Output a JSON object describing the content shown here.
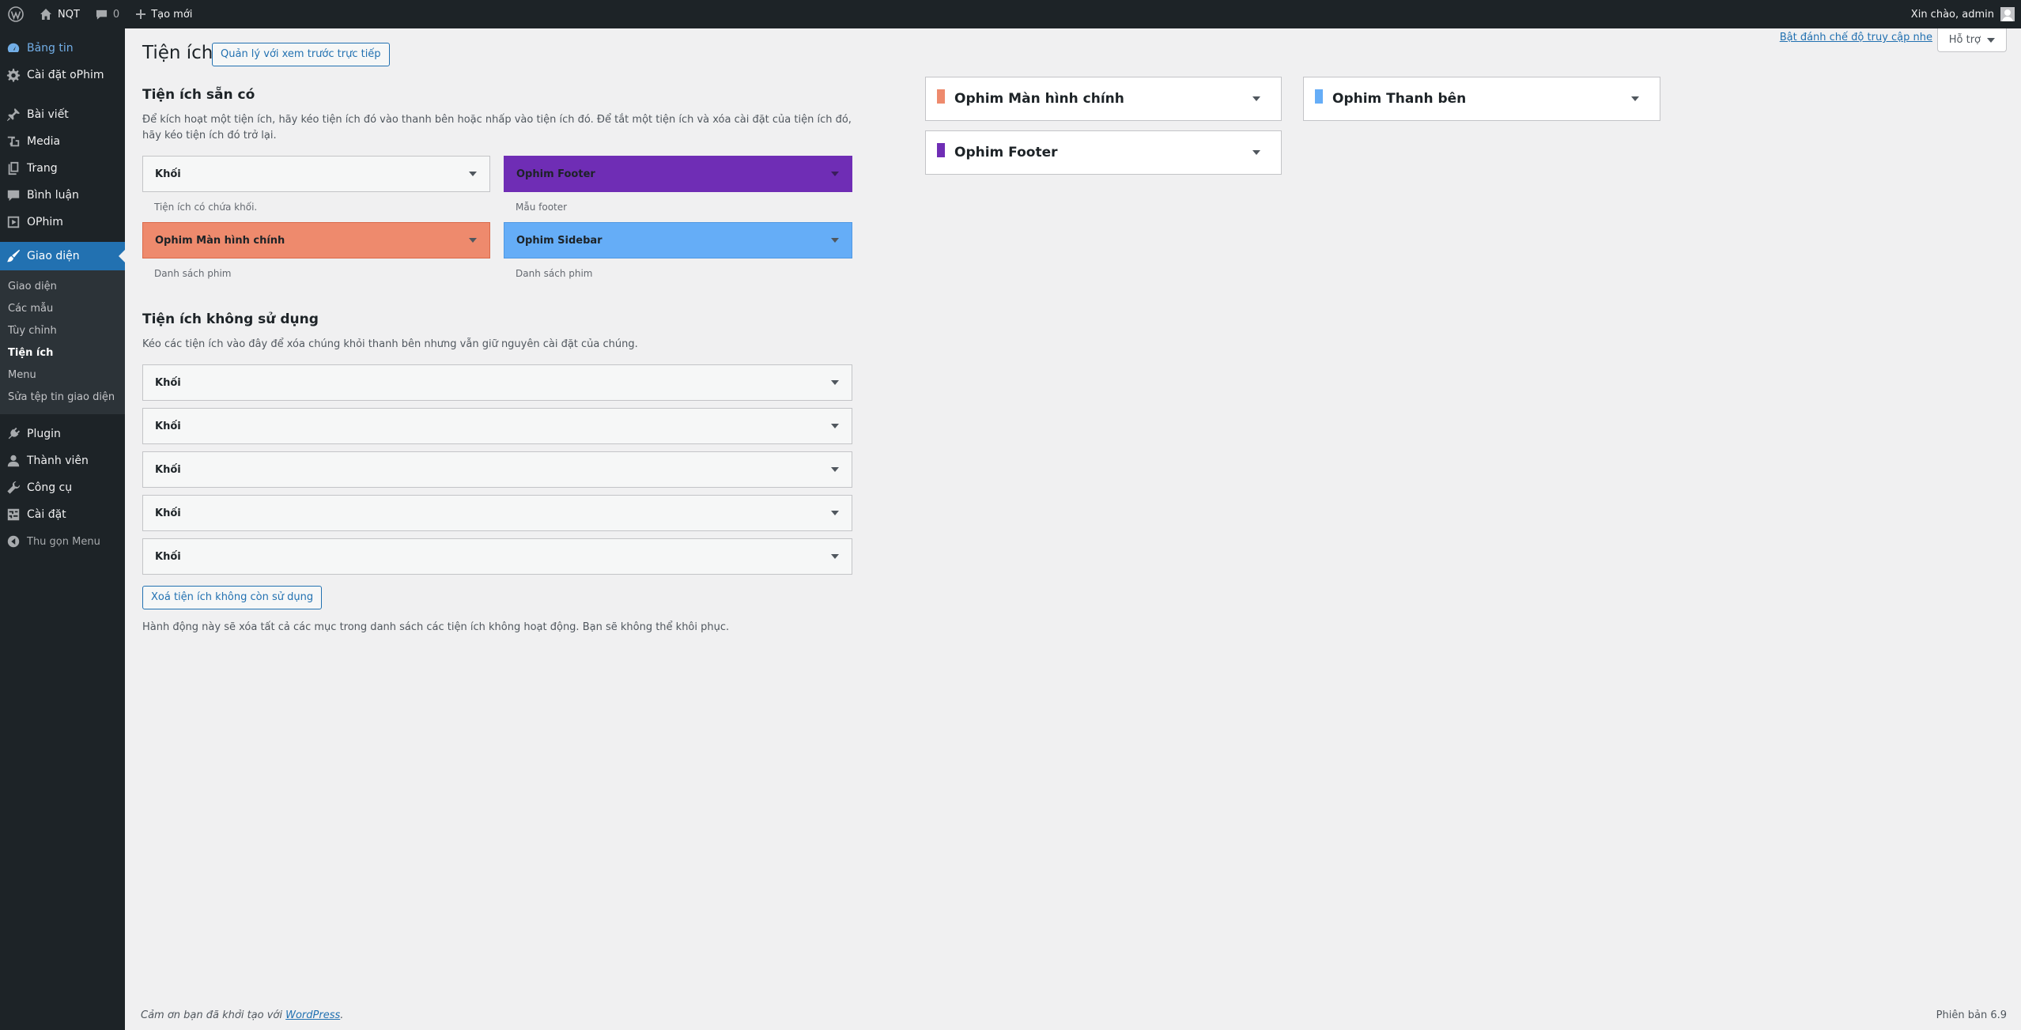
{
  "adminbar": {
    "site_name": "NQT",
    "comments_count": "0",
    "new_label": "Tạo mới",
    "greeting": "Xin chào, admin"
  },
  "menu": {
    "items_top": [
      {
        "label": "Bảng tin",
        "icon": "dashboard-icon"
      },
      {
        "label": "Cài đặt oPhim",
        "icon": "gear-icon"
      }
    ],
    "items_mid": [
      {
        "label": "Bài viết",
        "icon": "pin-icon"
      },
      {
        "label": "Media",
        "icon": "media-icon"
      },
      {
        "label": "Trang",
        "icon": "pages-icon"
      },
      {
        "label": "Bình luận",
        "icon": "comment-icon"
      },
      {
        "label": "OPhim",
        "icon": "video-icon"
      }
    ],
    "active": {
      "label": "Giao diện",
      "icon": "brush-icon"
    },
    "submenu": [
      "Giao diện",
      "Các mẫu",
      "Tùy chỉnh",
      "Tiện ích",
      "Menu",
      "Sửa tệp tin giao diện"
    ],
    "submenu_current": "Tiện ích",
    "items_bottom": [
      {
        "label": "Plugin",
        "icon": "plugin-icon"
      },
      {
        "label": "Thành viên",
        "icon": "user-icon"
      },
      {
        "label": "Công cụ",
        "icon": "wrench-icon"
      },
      {
        "label": "Cài đặt",
        "icon": "settings-icon"
      }
    ],
    "collapse_label": "Thu gọn Menu"
  },
  "header": {
    "title": "Tiện ích",
    "manage_live_label": "Quản lý với xem trước trực tiếp",
    "screen_reader_link": "Bật đánh chế độ truy cập nhe",
    "help_label": "Hỗ trợ"
  },
  "available": {
    "title": "Tiện ích sẵn có",
    "description": "Để kích hoạt một tiện ích, hãy kéo tiện ích đó vào thanh bên hoặc nhấp vào tiện ích đó. Để tắt một tiện ích và xóa cài đặt của tiện ích đó, hãy kéo tiện ích đó trở lại.",
    "widgets": [
      {
        "label": "Khối",
        "desc": "Tiện ích có chứa khối.",
        "color": "#f6f7f7"
      },
      {
        "label": "Ophim Footer",
        "desc": "Mẫu footer",
        "color": "#6f2db5"
      },
      {
        "label": "Ophim Màn hình chính",
        "desc": "Danh sách phim",
        "color": "#ee8a6d"
      },
      {
        "label": "Ophim Sidebar",
        "desc": "Danh sách phim",
        "color": "#65adf7"
      }
    ]
  },
  "inactive": {
    "title": "Tiện ích không sử dụng",
    "description": "Kéo các tiện ích vào đây để xóa chúng khỏi thanh bên nhưng vẫn giữ nguyên cài đặt của chúng.",
    "widgets": [
      "Khối",
      "Khối",
      "Khối",
      "Khối",
      "Khối"
    ],
    "clear_button": "Xoá tiện ích không còn sử dụng",
    "clear_note": "Hành động này sẽ xóa tất cả các mục trong danh sách các tiện ích không hoạt động. Bạn sẽ không thể khôi phục."
  },
  "sidebars": [
    {
      "label": "Ophim Màn hình chính",
      "color": "#ee8a6d"
    },
    {
      "label": "Ophim Thanh bên",
      "color": "#65adf7"
    },
    {
      "label": "Ophim Footer",
      "color": "#6f2db5"
    }
  ],
  "footer": {
    "thanks_prefix": "Cảm ơn bạn đã khởi tạo với ",
    "thanks_link": "WordPress",
    "thanks_suffix": ".",
    "version": "Phiên bản 6.9"
  }
}
